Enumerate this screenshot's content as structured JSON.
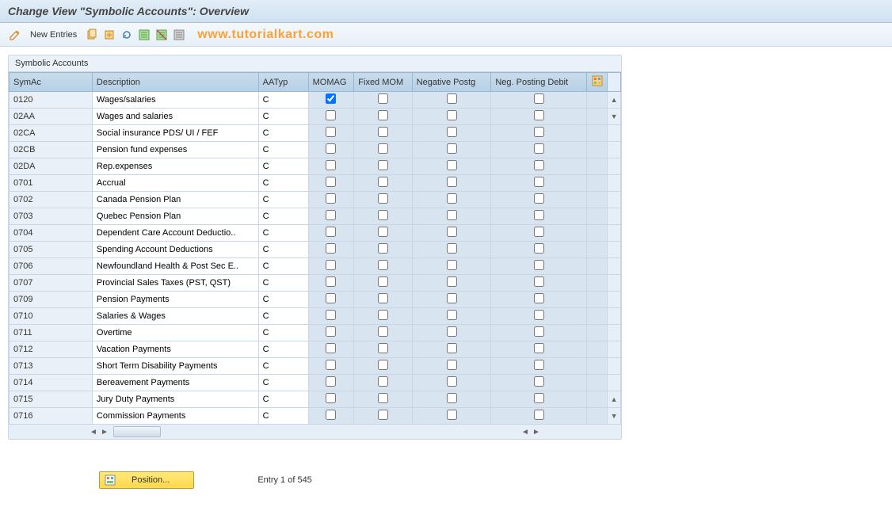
{
  "title": "Change View \"Symbolic Accounts\": Overview",
  "toolbar": {
    "new_entries": "New Entries"
  },
  "watermark": "www.tutorialkart.com",
  "panel": {
    "title": "Symbolic Accounts"
  },
  "columns": {
    "symac": "SymAc",
    "description": "Description",
    "aatyp": "AATyp",
    "momag": "MOMAG",
    "fixed_mom": "Fixed MOM",
    "negative_postg": "Negative Postg",
    "neg_posting_debit": "Neg. Posting Debit"
  },
  "rows": [
    {
      "symac": "0120",
      "description": "Wages/salaries",
      "aatyp": "C",
      "momag": true,
      "fixed": false,
      "neg": false,
      "negd": false,
      "sel": true
    },
    {
      "symac": "02AA",
      "description": "Wages and salaries",
      "aatyp": "C",
      "momag": false,
      "fixed": false,
      "neg": false,
      "negd": false
    },
    {
      "symac": "02CA",
      "description": "Social insurance PDS/ UI / FEF",
      "aatyp": "C",
      "momag": false,
      "fixed": false,
      "neg": false,
      "negd": false
    },
    {
      "symac": "02CB",
      "description": "Pension fund expenses",
      "aatyp": "C",
      "momag": false,
      "fixed": false,
      "neg": false,
      "negd": false
    },
    {
      "symac": "02DA",
      "description": "Rep.expenses",
      "aatyp": "C",
      "momag": false,
      "fixed": false,
      "neg": false,
      "negd": false
    },
    {
      "symac": "0701",
      "description": "Accrual",
      "aatyp": "C",
      "momag": false,
      "fixed": false,
      "neg": false,
      "negd": false
    },
    {
      "symac": "0702",
      "description": "Canada Pension Plan",
      "aatyp": "C",
      "momag": false,
      "fixed": false,
      "neg": false,
      "negd": false
    },
    {
      "symac": "0703",
      "description": "Quebec Pension Plan",
      "aatyp": "C",
      "momag": false,
      "fixed": false,
      "neg": false,
      "negd": false
    },
    {
      "symac": "0704",
      "description": "Dependent Care Account Deductio..",
      "aatyp": "C",
      "momag": false,
      "fixed": false,
      "neg": false,
      "negd": false
    },
    {
      "symac": "0705",
      "description": "Spending Account Deductions",
      "aatyp": "C",
      "momag": false,
      "fixed": false,
      "neg": false,
      "negd": false
    },
    {
      "symac": "0706",
      "description": "Newfoundland Health & Post Sec E..",
      "aatyp": "C",
      "momag": false,
      "fixed": false,
      "neg": false,
      "negd": false
    },
    {
      "symac": "0707",
      "description": "Provincial Sales Taxes (PST, QST)",
      "aatyp": "C",
      "momag": false,
      "fixed": false,
      "neg": false,
      "negd": false
    },
    {
      "symac": "0709",
      "description": "Pension Payments",
      "aatyp": "C",
      "momag": false,
      "fixed": false,
      "neg": false,
      "negd": false
    },
    {
      "symac": "0710",
      "description": "Salaries & Wages",
      "aatyp": "C",
      "momag": false,
      "fixed": false,
      "neg": false,
      "negd": false
    },
    {
      "symac": "0711",
      "description": "Overtime",
      "aatyp": "C",
      "momag": false,
      "fixed": false,
      "neg": false,
      "negd": false
    },
    {
      "symac": "0712",
      "description": "Vacation Payments",
      "aatyp": "C",
      "momag": false,
      "fixed": false,
      "neg": false,
      "negd": false
    },
    {
      "symac": "0713",
      "description": "Short Term Disability Payments",
      "aatyp": "C",
      "momag": false,
      "fixed": false,
      "neg": false,
      "negd": false
    },
    {
      "symac": "0714",
      "description": "Bereavement Payments",
      "aatyp": "C",
      "momag": false,
      "fixed": false,
      "neg": false,
      "negd": false
    },
    {
      "symac": "0715",
      "description": "Jury Duty Payments",
      "aatyp": "C",
      "momag": false,
      "fixed": false,
      "neg": false,
      "negd": false
    },
    {
      "symac": "0716",
      "description": "Commission Payments",
      "aatyp": "C",
      "momag": false,
      "fixed": false,
      "neg": false,
      "negd": false
    }
  ],
  "footer": {
    "position_btn": "Position...",
    "entry_text": "Entry 1 of 545"
  }
}
